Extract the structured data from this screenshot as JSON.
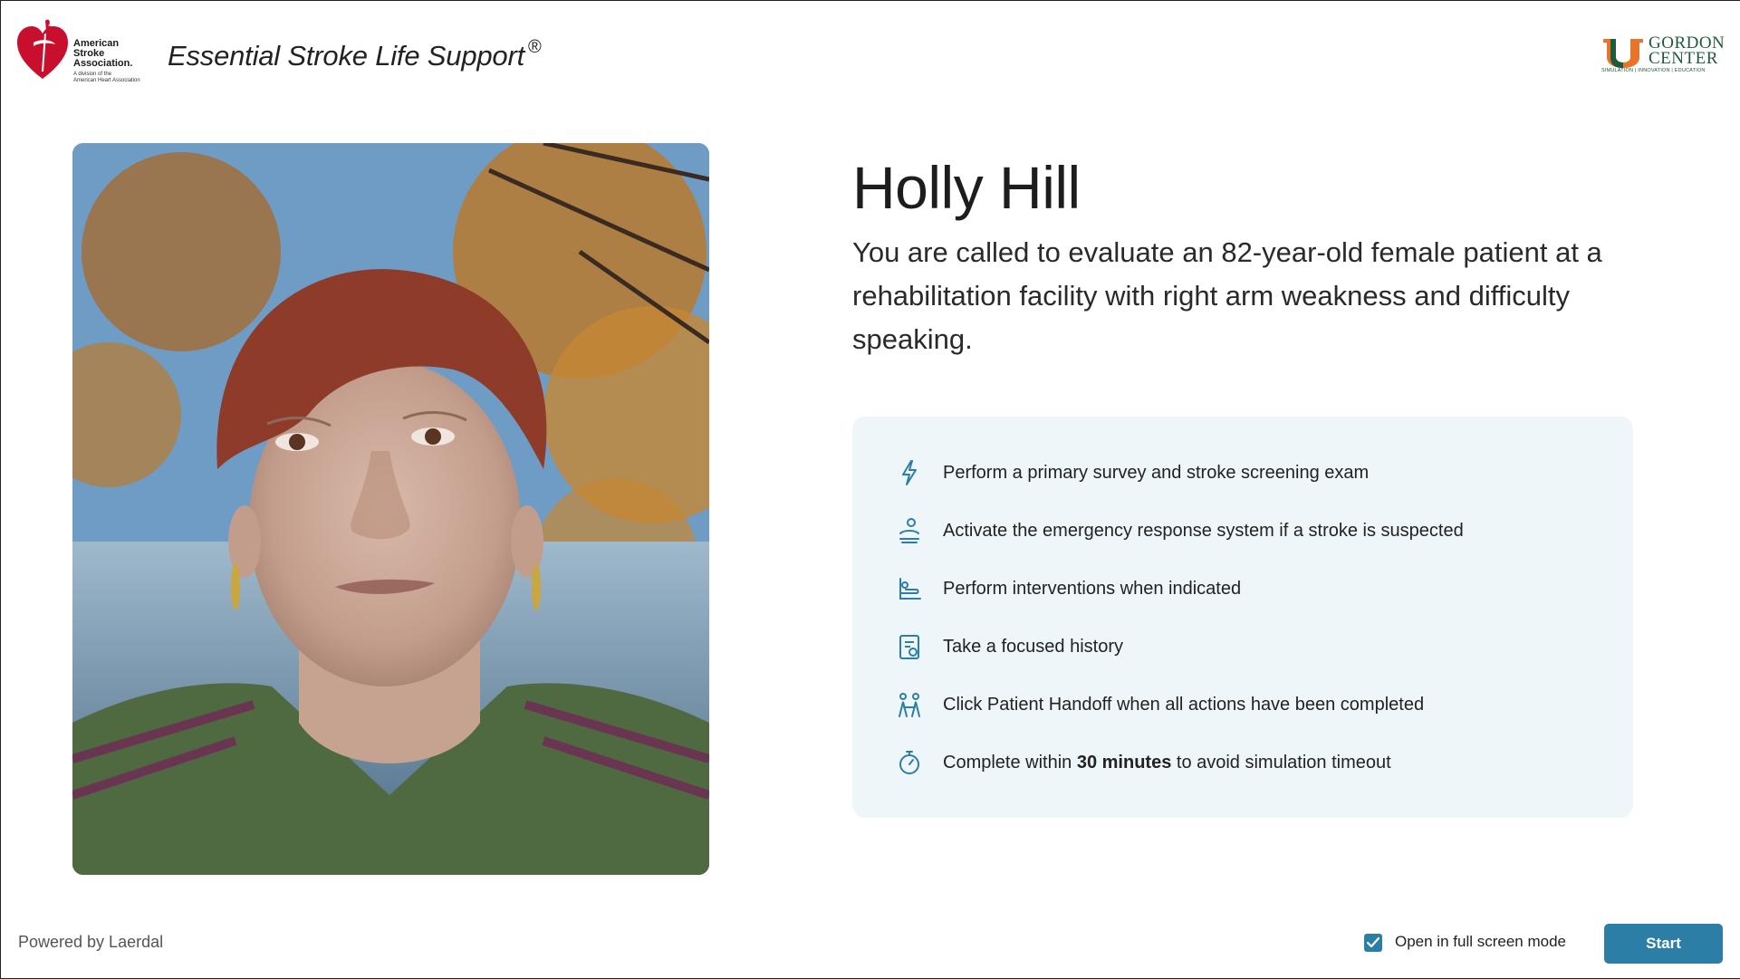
{
  "header": {
    "org_logo_lines": [
      "American",
      "Stroke",
      "Association."
    ],
    "org_logo_sub": [
      "A division of the",
      "American Heart Association"
    ],
    "app_title": "Essential Stroke Life Support",
    "registered_mark": "®",
    "partner_logo_lines": [
      "GORDON",
      "CENTER"
    ],
    "partner_logo_sub": "SIMULATION | INNOVATION | EDUCATION"
  },
  "patient": {
    "name": "Holly Hill",
    "scenario": "You are called to evaluate an 82-year-old female patient at a rehabilitation facility with right arm weakness and difficulty speaking."
  },
  "tasks": [
    {
      "icon": "lightning-icon",
      "text": "Perform a primary survey and stroke screening exam"
    },
    {
      "icon": "emergency-call-icon",
      "text": "Activate the emergency response system if a stroke is suspected"
    },
    {
      "icon": "intervention-icon",
      "text": "Perform interventions when indicated"
    },
    {
      "icon": "history-clipboard-icon",
      "text": "Take a focused history"
    },
    {
      "icon": "handoff-icon",
      "text": "Click Patient Handoff when all actions have been completed"
    },
    {
      "icon": "stopwatch-icon",
      "text_before": "Complete within ",
      "text_bold": "30 minutes",
      "text_after": " to avoid simulation timeout"
    }
  ],
  "footer": {
    "powered_by": "Powered by Laerdal",
    "fullscreen_label": "Open in full screen mode",
    "fullscreen_checked": true,
    "start_label": "Start"
  },
  "colors": {
    "accent": "#2d7ea6",
    "panel_bg": "#eef6f9",
    "aha_red": "#c8102e",
    "partner_green": "#1f5a3a",
    "partner_orange": "#e8742a"
  }
}
